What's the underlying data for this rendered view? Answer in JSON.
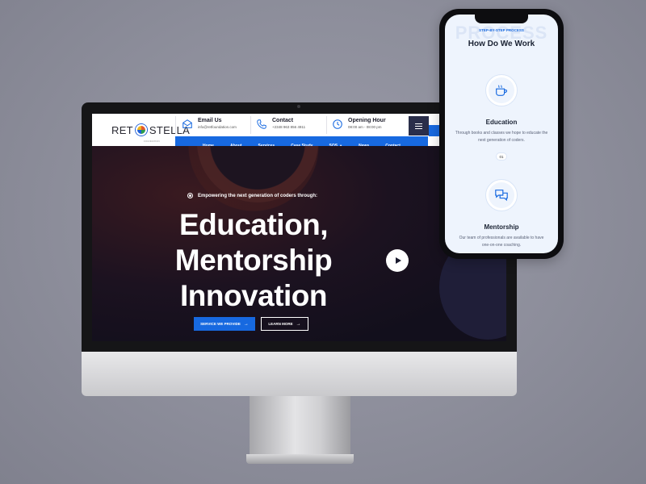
{
  "site": {
    "logo": {
      "left": "RET",
      "right": "STELLA",
      "tagline": "FOUNDATION"
    },
    "header_info": [
      {
        "title": "Email Us",
        "sub": "info@retfoundation.com",
        "icon": "mail-icon"
      },
      {
        "title": "Contact",
        "sub": "+2348 963 856 4911",
        "icon": "phone-icon"
      },
      {
        "title": "Opening Hour",
        "sub": "08:00 am - 08:00 pm",
        "icon": "clock-icon"
      }
    ],
    "nav": [
      "Home",
      "About",
      "Services",
      "Case Study",
      "SOS",
      "News",
      "Contact"
    ],
    "hero": {
      "tagline": "Empowering the next generation of coders through:",
      "title_line1": "Education,",
      "title_line2": "Mentorship",
      "title_line3": "Innovation",
      "primary_button": "SERVICE WE PROVIDE",
      "secondary_button": "LEARN MORE"
    }
  },
  "mobile": {
    "background_word": "PROCESS",
    "eyebrow": "STEP-BY-STEP PROCESS",
    "title": "How Do We Work",
    "cards": [
      {
        "title": "Education",
        "desc": "Through books and classes we hope to educate the next generation of coders.",
        "number": "01",
        "icon": "coffee-cup-icon"
      },
      {
        "title": "Mentorship",
        "desc": "Our team of professionals are available to have one-on-one coaching.",
        "icon": "chat-bubbles-icon"
      }
    ]
  },
  "colors": {
    "brand_blue": "#1769e0",
    "hero_dark": "#14101c",
    "nav_dark": "#2a2e4a"
  }
}
